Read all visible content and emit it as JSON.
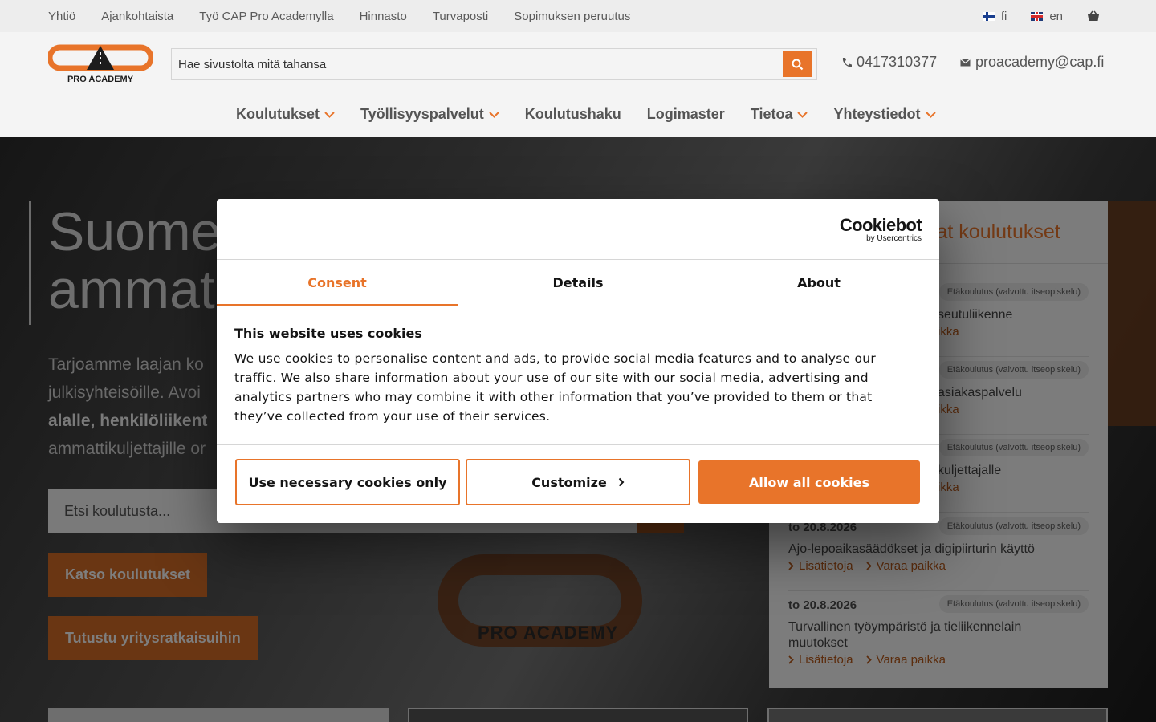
{
  "topbar": {
    "links": [
      "Yhtiö",
      "Ajankohtaista",
      "Työ CAP Pro Academylla",
      "Hinnasto",
      "Turvaposti",
      "Sopimuksen peruutus"
    ],
    "languages": [
      {
        "code": "fi",
        "label": "fi"
      },
      {
        "code": "en",
        "label": "en"
      }
    ]
  },
  "header": {
    "logo_text": "PRO ACADEMY",
    "search_placeholder": "Hae sivustolta mitä tahansa",
    "phone": "0417310377",
    "email": "proacademy@cap.fi",
    "nav": [
      {
        "label": "Koulutukset",
        "dropdown": true
      },
      {
        "label": "Työllisyyspalvelut",
        "dropdown": true
      },
      {
        "label": "Koulutushaku",
        "dropdown": false
      },
      {
        "label": "Logimaster",
        "dropdown": false
      },
      {
        "label": "Tietoa",
        "dropdown": true
      },
      {
        "label": "Yhteystiedot",
        "dropdown": true
      }
    ]
  },
  "hero": {
    "title_line1": "Suome",
    "title_line2": "ammat",
    "lead_1": "Tarjoamme laajan ko",
    "lead_2": "julkisyhteisöille. Avoi",
    "lead_3": "alalle, henkilöliikent",
    "lead_4": "ammattikuljettajille or",
    "search_placeholder": "Etsi koulutusta...",
    "cta_primary": "Katso koulutukset",
    "cta_secondary": "Tutustu yritysratkaisuihin",
    "deco_logo_text": "PRO ACADEMY"
  },
  "upcoming": {
    "title_fragment": "vat koulutukset",
    "courses": [
      {
        "date": "",
        "badge": "Etäkoulutus (valvottu itseopiskelu)",
        "name": "seutuliikenne",
        "more": "",
        "book": "ikka"
      },
      {
        "date": "",
        "badge": "Etäkoulutus (valvottu itseopiskelu)",
        "name": "asiakaspalvelu",
        "more": "",
        "book": "ikka"
      },
      {
        "date": "",
        "badge": "Etäkoulutus (valvottu itseopiskelu)",
        "name": "kuljettajalle",
        "more": "",
        "book": "ikka"
      },
      {
        "date": "to 20.8.2026",
        "badge": "Etäkoulutus (valvottu itseopiskelu)",
        "name": "Ajo-lepoaikasäädökset ja digipiirturin käyttö",
        "more": "Lisätietoja",
        "book": "Varaa paikka"
      },
      {
        "date": "to 20.8.2026",
        "badge": "Etäkoulutus (valvottu itseopiskelu)",
        "name": "Turvallinen työympäristö ja tieliikennelain muutokset",
        "more": "Lisätietoja",
        "book": "Varaa paikka"
      }
    ]
  },
  "cookie_dialog": {
    "brand": "Cookiebot",
    "brand_sub": "by Usercentrics",
    "tabs": [
      "Consent",
      "Details",
      "About"
    ],
    "active_tab": "Consent",
    "heading": "This website uses cookies",
    "body": "We use cookies to personalise content and ads, to provide social media features and to analyse our traffic. We also share information about your use of our site with our social media, advertising and analytics partners who may combine it with other information that you’ve provided to them or that they’ve collected from your use of their services.",
    "btn_necessary": "Use necessary cookies only",
    "btn_customize": "Customize",
    "btn_allow": "Allow all cookies"
  },
  "colors": {
    "accent": "#e8742a",
    "text": "#141414",
    "topbar_bg": "#ededed",
    "header_bg": "#f4f4f4"
  }
}
